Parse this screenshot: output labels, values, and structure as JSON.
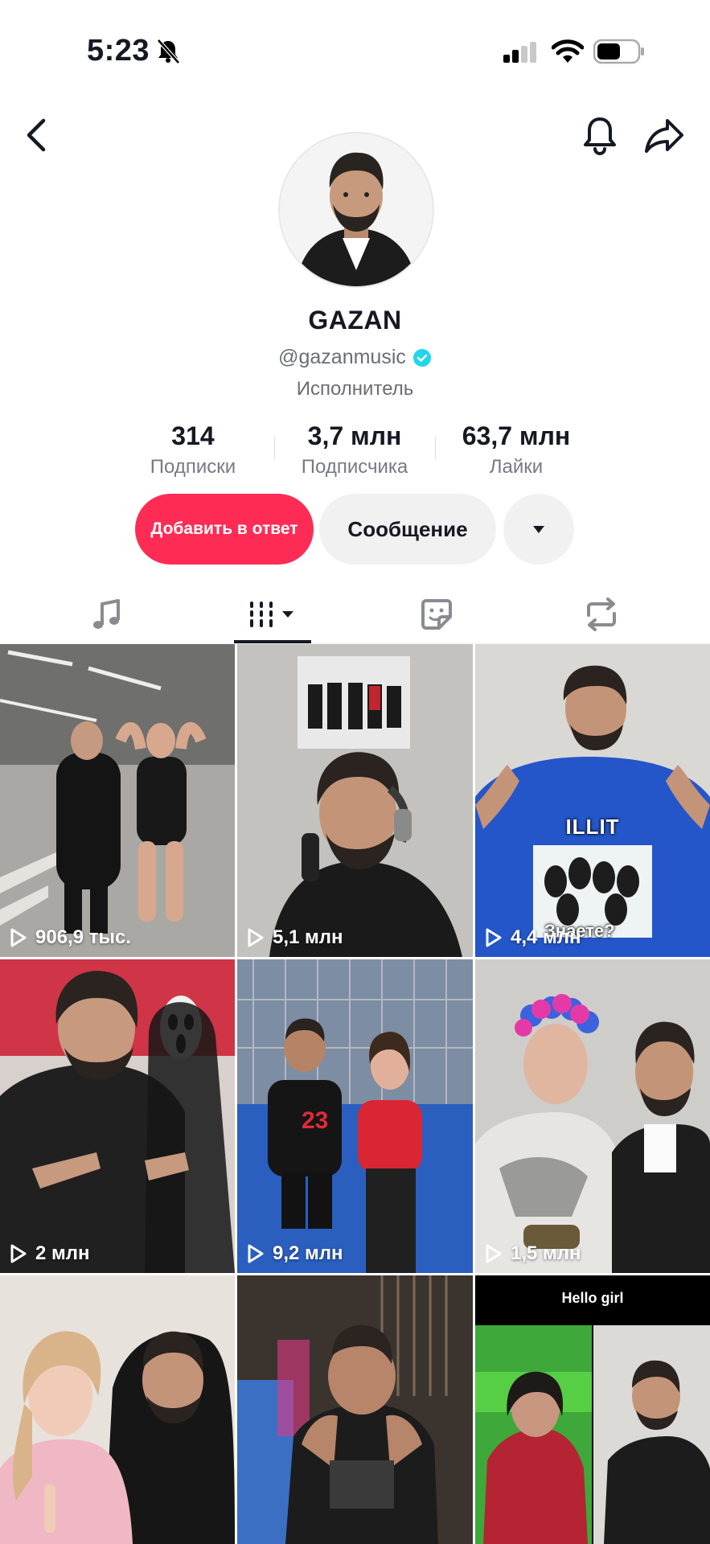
{
  "status_bar": {
    "time": "5:23"
  },
  "profile": {
    "name": "GAZAN",
    "handle": "@gazanmusic",
    "role": "Исполнитель"
  },
  "stats": [
    {
      "value": "314",
      "label": "Подписки"
    },
    {
      "value": "3,7 млн",
      "label": "Подписчика"
    },
    {
      "value": "63,7 млн",
      "label": "Лайки"
    }
  ],
  "actions": {
    "add_reply": "Добавить в ответ",
    "message": "Сообщение"
  },
  "tabs": [
    "music-icon",
    "videos-grid-icon",
    "sticker-icon",
    "repost-icon"
  ],
  "colors": {
    "accent": "#fe2c55",
    "verified": "#20d5ec"
  },
  "videos": [
    {
      "views": "906,9 тыс."
    },
    {
      "views": "5,1 млн"
    },
    {
      "views": "4,4 млн",
      "overlay": "ILLIT",
      "caption": "Знаете?"
    },
    {
      "views": "2 млн"
    },
    {
      "views": "9,2 млн",
      "jersey": "23"
    },
    {
      "views": "1,5 млн"
    },
    {
      "views": ""
    },
    {
      "views": ""
    },
    {
      "views": "",
      "overlay": "Hello girl"
    }
  ]
}
